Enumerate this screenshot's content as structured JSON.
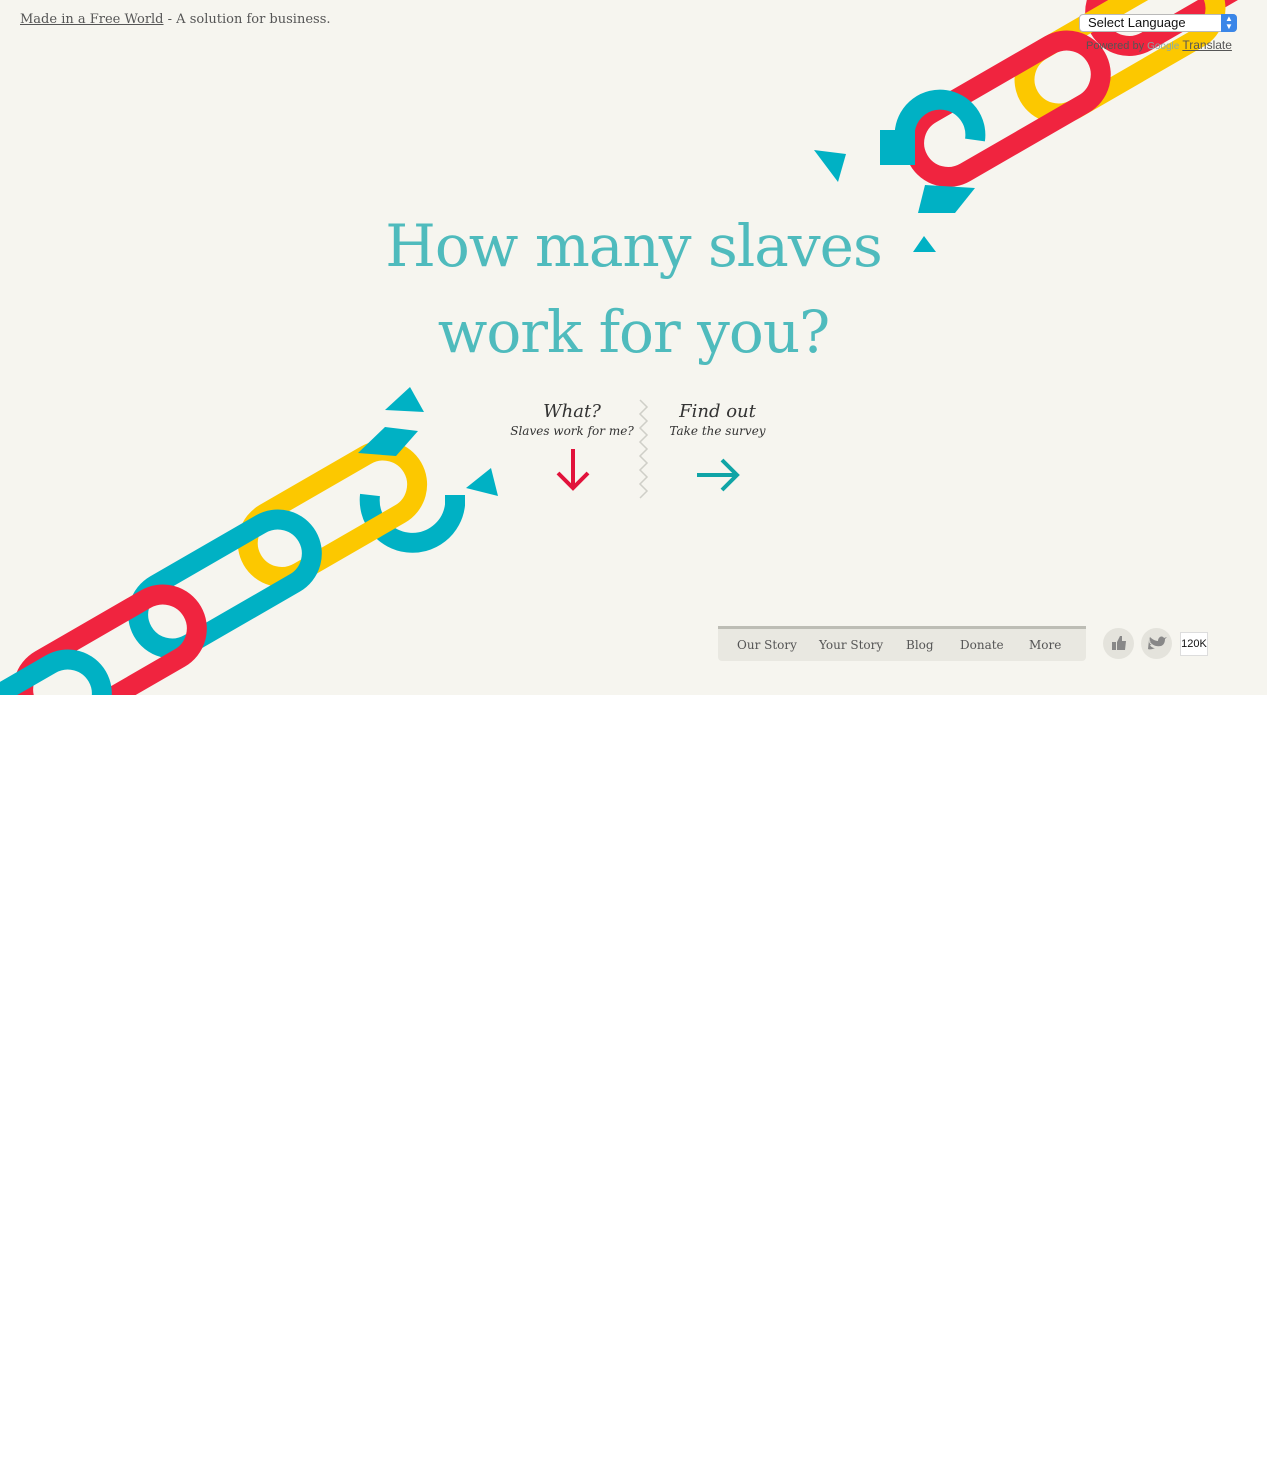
{
  "topbar": {
    "site_link": "Made in a Free World",
    "tagline": "- A solution for business."
  },
  "translate": {
    "select_label": "Select Language",
    "powered_by": "Powered by",
    "google": "Google",
    "translate_link": "Translate"
  },
  "hero": {
    "headline_line1": "How many slaves",
    "headline_line2": "work for you?"
  },
  "cta": {
    "what_title": "What?",
    "what_sub": "Slaves work for me?",
    "find_title": "Find out",
    "find_sub": "Take the survey"
  },
  "nav": {
    "items": [
      "Our Story",
      "Your Story",
      "Blog",
      "Donate",
      "More"
    ]
  },
  "social": {
    "like_icon": "thumbs-up-icon",
    "twitter_icon": "twitter-bird-icon",
    "count": "120K"
  },
  "colors": {
    "background": "#f6f5ef",
    "teal": "#4fbbbd",
    "chain_red": "#f0243f",
    "chain_yellow": "#fcc800",
    "chain_blue": "#00b1c4",
    "arrow_red": "#e2123b",
    "arrow_teal": "#10a4a6"
  }
}
